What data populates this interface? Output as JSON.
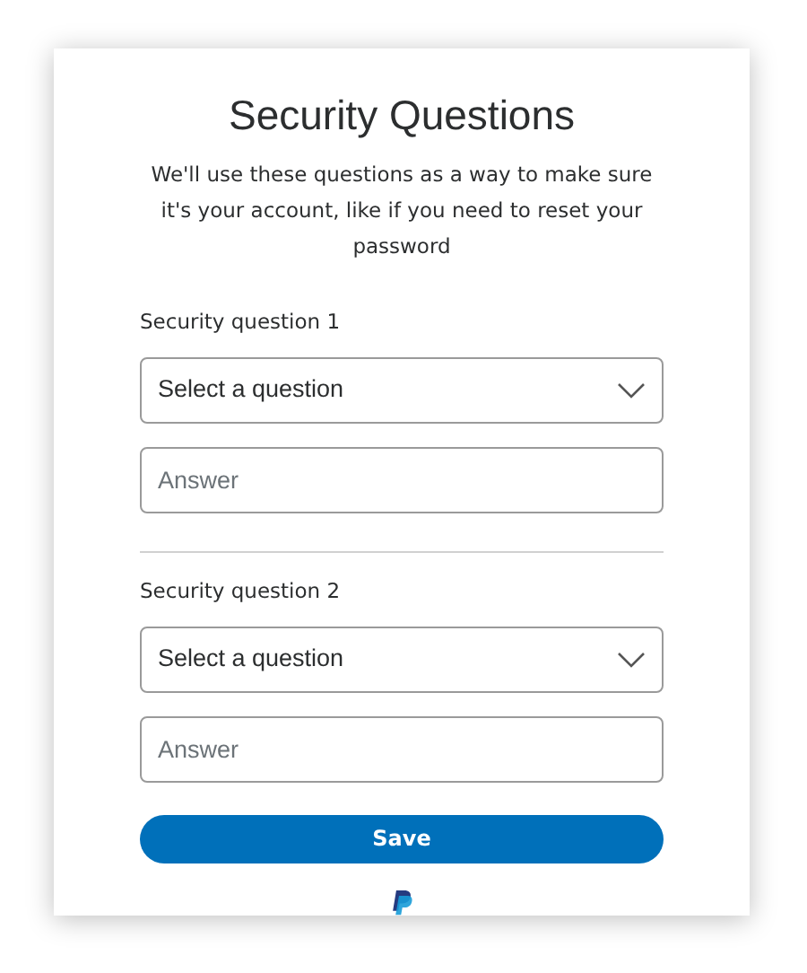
{
  "title": "Security Questions",
  "description": "We'll use these questions as a way to make sure it's your account, like if you need to reset your password",
  "questions": [
    {
      "label": "Security question 1",
      "select": "Select a question",
      "answer": {
        "placeholder": "Answer"
      }
    },
    {
      "label": "Security question 2",
      "select": "Select a question",
      "answer": {
        "placeholder": "Answer"
      }
    }
  ],
  "save_button": "Save"
}
